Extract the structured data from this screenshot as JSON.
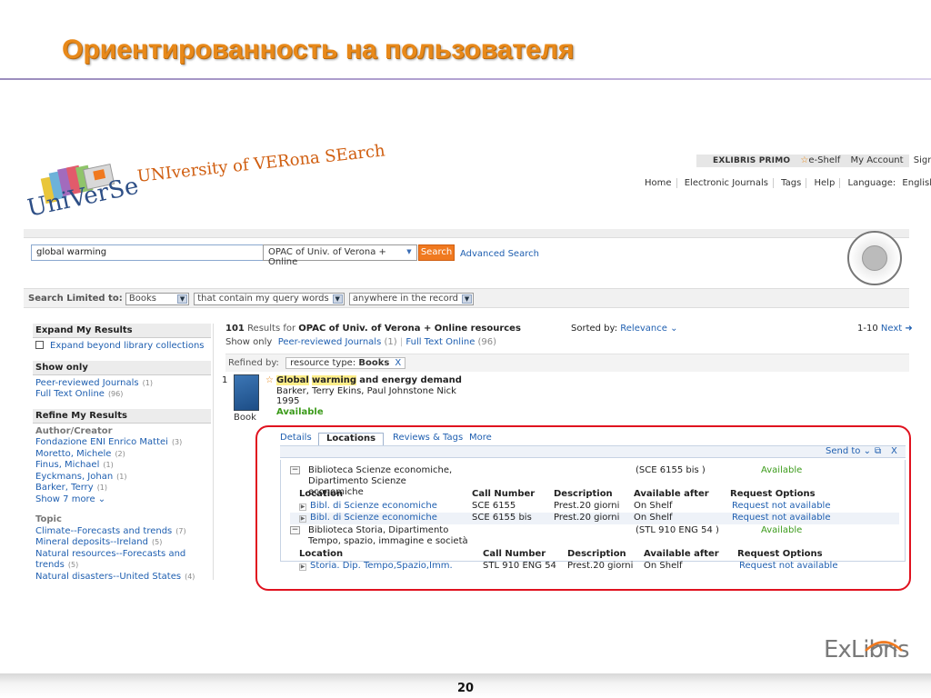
{
  "slide": {
    "title": "Ориентированность на пользователя",
    "page_number": "20",
    "brand": "ExLibris"
  },
  "topbar": {
    "product": "EXLIBRIS PRIMO",
    "eshelf": "e-Shelf",
    "my_account": "My Account",
    "sign_out": "Sign out"
  },
  "logo": {
    "tagline": "UNIversity of VERona SEarch",
    "short": "UniVerSe"
  },
  "nav": {
    "home": "Home",
    "journals": "Electronic Journals",
    "tags": "Tags",
    "help": "Help",
    "language_label": "Language:",
    "language": "English"
  },
  "search": {
    "query": "global warming",
    "scope": "OPAC of Univ. of Verona + Online",
    "button": "Search",
    "advanced": "Advanced Search"
  },
  "limit": {
    "label": "Search Limited to:",
    "type": "Books",
    "condition": "that contain my query words",
    "field": "anywhere in the record"
  },
  "sidebar": {
    "expand_head": "Expand My Results",
    "expand_item": "Expand beyond library collections",
    "show_head": "Show only",
    "show_items": [
      {
        "label": "Peer-reviewed Journals",
        "count": "(1)"
      },
      {
        "label": "Full Text Online",
        "count": "(96)"
      }
    ],
    "refine_head": "Refine My Results",
    "author_title": "Author/Creator",
    "authors": [
      {
        "label": "Fondazione ENI Enrico Mattei",
        "count": "(3)"
      },
      {
        "label": "Moretto, Michele",
        "count": "(2)"
      },
      {
        "label": "Finus, Michael",
        "count": "(1)"
      },
      {
        "label": "Eyckmans, Johan",
        "count": "(1)"
      },
      {
        "label": "Barker, Terry",
        "count": "(1)"
      }
    ],
    "show_more": "Show 7 more",
    "topic_title": "Topic",
    "topics": [
      {
        "label": "Climate--Forecasts and trends",
        "count": "(7)"
      },
      {
        "label": "Mineral deposits--Ireland",
        "count": "(5)"
      },
      {
        "label": "Natural resources--Forecasts and trends",
        "count": "(5)"
      },
      {
        "label": "Natural disasters--United States",
        "count": "(4)"
      }
    ]
  },
  "results": {
    "count": "101",
    "results_for": "Results for",
    "scope": "OPAC of Univ. of Verona + Online resources",
    "sorted_label": "Sorted by:",
    "sorted_value": "Relevance",
    "range": "1-10",
    "next": "Next",
    "show_only_label": "Show only",
    "show_only": [
      {
        "label": "Peer-reviewed Journals",
        "count": "(1)"
      },
      {
        "label": "Full Text Online",
        "count": "(96)"
      }
    ],
    "refined_label": "Refined by:",
    "facet_label": "resource type:",
    "facet_value": "Books",
    "facet_remove": "X"
  },
  "record": {
    "num": "1",
    "title_a": "Global",
    "title_b": "warming",
    "title_c": "and energy demand",
    "authors": "Barker, Terry Ekins, Paul Johnstone Nick",
    "year": "1995",
    "availability": "Available",
    "format": "Book"
  },
  "panel": {
    "tabs": [
      "Details",
      "Locations",
      "Reviews & Tags",
      "More"
    ],
    "send_to": "Send to",
    "close": "X",
    "columns": [
      "Location",
      "Call Number",
      "Description",
      "Available after",
      "Request Options"
    ],
    "libraries": [
      {
        "name": "Biblioteca Scienze economiche, Dipartimento Scienze economiche",
        "call": "(SCE 6155 bis )",
        "status": "Available",
        "rows": [
          {
            "location": "Bibl. di Scienze economiche",
            "call": "SCE 6155",
            "desc": "Prest.20 giorni",
            "after": "On Shelf",
            "request": "Request not available"
          },
          {
            "location": "Bibl. di Scienze economiche",
            "call": "SCE 6155 bis",
            "desc": "Prest.20 giorni",
            "after": "On Shelf",
            "request": "Request not available"
          }
        ]
      },
      {
        "name": "Biblioteca Storia, Dipartimento Tempo, spazio, immagine e società",
        "call": "(STL 910 ENG 54 )",
        "status": "Available",
        "rows": [
          {
            "location": "Storia. Dip. Tempo,Spazio,Imm.",
            "call": "STL 910 ENG 54",
            "desc": "Prest.20 giorni",
            "after": "On Shelf",
            "request": "Request not available"
          }
        ]
      }
    ]
  },
  "colors": {
    "title": "#e8891a",
    "link": "#1f5fb0",
    "search_button": "#f0791f",
    "available": "#3c9b1b",
    "highlight_border": "#e0121f"
  }
}
